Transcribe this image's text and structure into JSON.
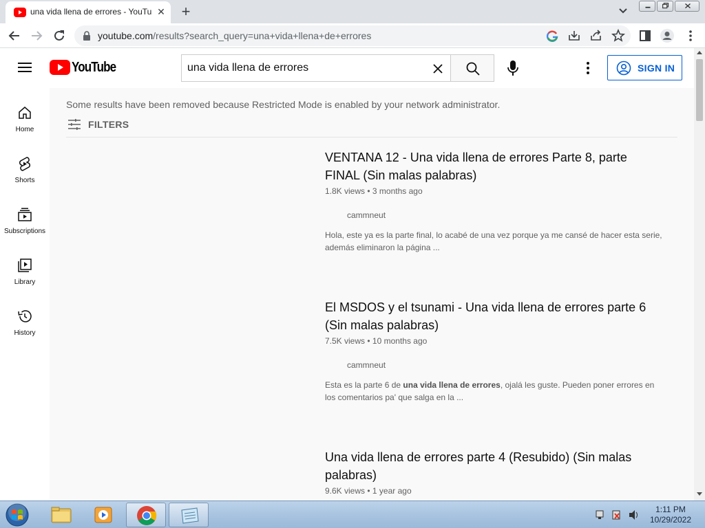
{
  "browser": {
    "tab_title": "una vida llena de errores - YouTube",
    "tab_close": "✕",
    "new_tab": "+",
    "url_host": "youtube.com",
    "url_path": "/results?search_query=una+vida+llena+de+errores"
  },
  "masthead": {
    "logo_text": "YouTube",
    "search_value": "una vida llena de errores",
    "signin_label": "SIGN IN"
  },
  "sidebar": {
    "items": [
      {
        "label": "Home",
        "icon": "home-icon"
      },
      {
        "label": "Shorts",
        "icon": "shorts-icon"
      },
      {
        "label": "Subscriptions",
        "icon": "subscriptions-icon"
      },
      {
        "label": "Library",
        "icon": "library-icon"
      },
      {
        "label": "History",
        "icon": "history-icon"
      }
    ]
  },
  "results": {
    "restricted_notice": "Some results have been removed because Restricted Mode is enabled by your network administrator.",
    "filters_label": "FILTERS",
    "items": [
      {
        "title": "VENTANA 12 - Una vida llena de errores Parte 8, parte FINAL (Sin malas palabras)",
        "views": "1.8K views",
        "age": "3 months ago",
        "channel": "cammneut",
        "description": "Hola, este ya es la parte final, lo acabé de una vez porque ya me cansé de hacer esta serie, además eliminaron la página ..."
      },
      {
        "title": "El MSDOS y el tsunami - Una vida llena de errores parte 6 (Sin malas palabras)",
        "views": "7.5K views",
        "age": "10 months ago",
        "channel": "cammneut",
        "description_pre": "Esta es la parte 6 de ",
        "description_bold": "una vida llena de errores",
        "description_post": ", ojalá les guste. Pueden poner errores en los comentarios pa' que salga en la ..."
      },
      {
        "title": "Una vida llena de errores parte 4 (Resubido) (Sin malas palabras)",
        "views": "9.6K views",
        "age": "1 year ago"
      }
    ],
    "meta_separator": "•"
  },
  "taskbar": {
    "time": "1:11 PM",
    "date": "10/29/2022"
  },
  "colors": {
    "yt_red": "#ff0000",
    "signin_blue": "#065fd4"
  }
}
